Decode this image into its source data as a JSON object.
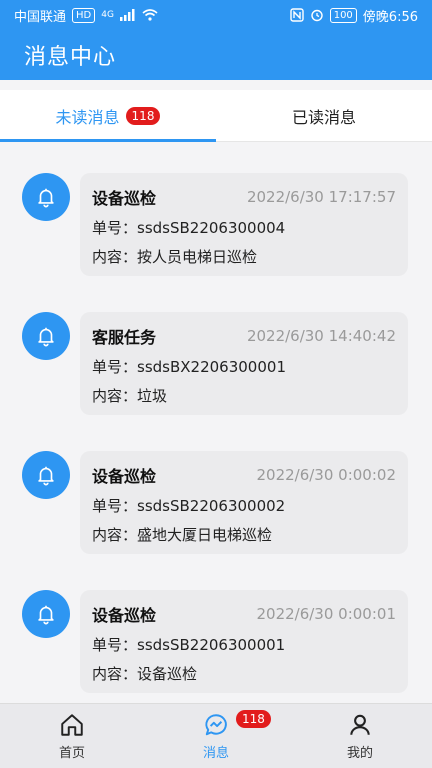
{
  "status": {
    "carrier": "中国联通",
    "hd": "HD",
    "network": "4G",
    "battery": "100",
    "time": "傍晚6:56"
  },
  "header": {
    "title": "消息中心"
  },
  "tabs": [
    {
      "label": "未读消息",
      "badge": "118"
    },
    {
      "label": "已读消息"
    }
  ],
  "labels": {
    "order_prefix": "单号：",
    "content_prefix": "内容："
  },
  "messages": [
    {
      "title": "设备巡检",
      "time": "2022/6/30 17:17:57",
      "order": "ssdsSB2206300004",
      "content": "按人员电梯日巡检"
    },
    {
      "title": "客服任务",
      "time": "2022/6/30 14:40:42",
      "order": "ssdsBX2206300001",
      "content": "垃圾"
    },
    {
      "title": "设备巡检",
      "time": "2022/6/30 0:00:02",
      "order": "ssdsSB2206300002",
      "content": "盛地大厦日电梯巡检"
    },
    {
      "title": "设备巡检",
      "time": "2022/6/30 0:00:01",
      "order": "ssdsSB2206300001",
      "content": "设备巡检"
    }
  ],
  "bottom_nav": [
    {
      "label": "首页",
      "icon": "home-icon"
    },
    {
      "label": "消息",
      "icon": "message-icon",
      "badge": "118"
    },
    {
      "label": "我的",
      "icon": "user-icon"
    }
  ],
  "colors": {
    "primary": "#2e96f2",
    "badge": "#e21c1c"
  }
}
